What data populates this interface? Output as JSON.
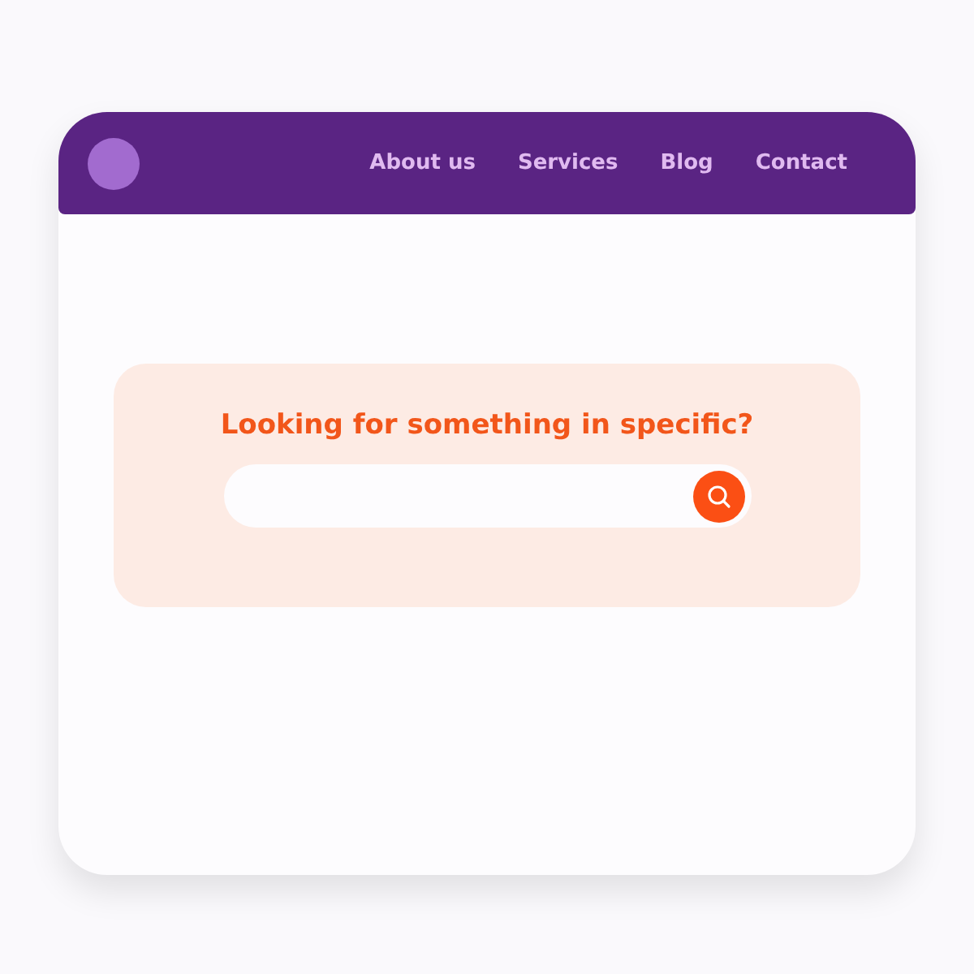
{
  "nav": {
    "items": [
      {
        "label": "About us"
      },
      {
        "label": "Services"
      },
      {
        "label": "Blog"
      },
      {
        "label": "Contact"
      }
    ]
  },
  "search_panel": {
    "heading": "Looking for something in specific?"
  }
}
